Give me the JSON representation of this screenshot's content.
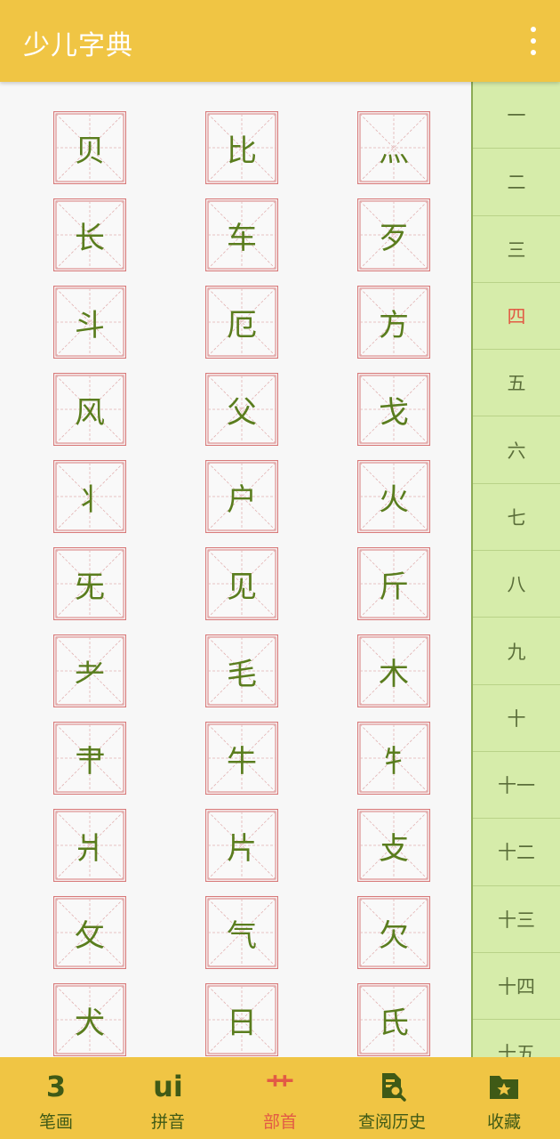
{
  "app": {
    "title": "少儿字典"
  },
  "radicals": [
    "贝",
    "比",
    "灬",
    "长",
    "车",
    "歹",
    "斗",
    "厄",
    "方",
    "风",
    "父",
    "戈",
    "丬",
    "户",
    "火",
    "旡",
    "见",
    "斤",
    "耂",
    "毛",
    "木",
    "肀",
    "牛",
    "牜",
    "爿",
    "片",
    "攴",
    "攵",
    "气",
    "欠",
    "犬",
    "日",
    "氏"
  ],
  "stroke_index": {
    "active": "四",
    "items": [
      "一",
      "二",
      "三",
      "四",
      "五",
      "六",
      "七",
      "八",
      "九",
      "十",
      "十一",
      "十二",
      "十三",
      "十四",
      "十五"
    ]
  },
  "tabs": [
    {
      "label": "笔画",
      "icon": "stroke-number-icon",
      "glyph": "3"
    },
    {
      "label": "拼音",
      "icon": "pinyin-icon",
      "glyph": "ui"
    },
    {
      "label": "部首",
      "icon": "radical-icon",
      "glyph": "艹",
      "active": true
    },
    {
      "label": "查阅历史",
      "icon": "history-search-icon"
    },
    {
      "label": "收藏",
      "icon": "favorites-folder-icon"
    }
  ],
  "colors": {
    "app_bar": "#f0c544",
    "character": "#5a7d1e",
    "grid_border": "#d87a7a",
    "sidebar": "#d6ecaa",
    "active": "#e25b45"
  }
}
